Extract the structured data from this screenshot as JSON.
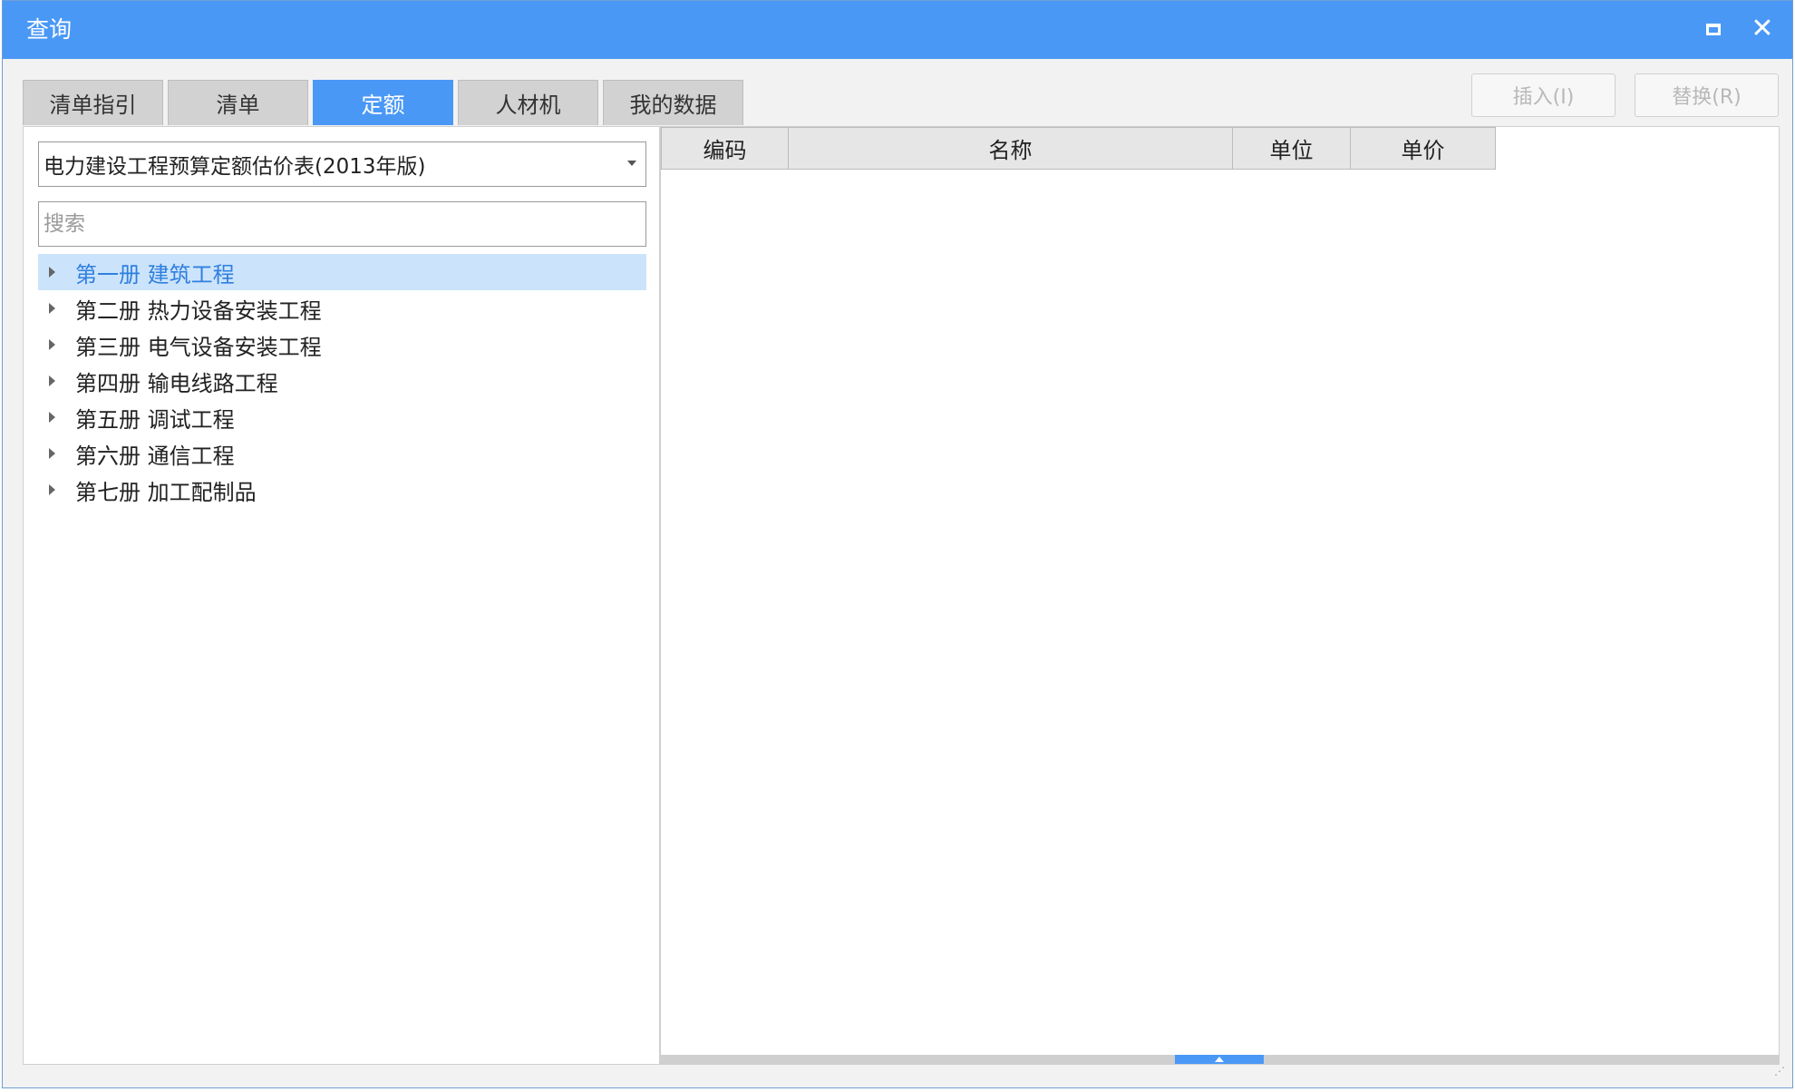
{
  "window": {
    "title": "查询",
    "maximize_icon": "maximize-icon",
    "close_icon": "close-icon",
    "accent_color": "#4a98f6"
  },
  "tabs": [
    {
      "label": "清单指引",
      "active": false
    },
    {
      "label": "清单",
      "active": false
    },
    {
      "label": "定额",
      "active": true
    },
    {
      "label": "人材机",
      "active": false
    },
    {
      "label": "我的数据",
      "active": false
    }
  ],
  "actions": {
    "insert_label": "插入(I)",
    "replace_label": "替换(R)"
  },
  "left": {
    "library_selected": "电力建设工程预算定额估价表(2013年版)",
    "search_placeholder": "搜索",
    "search_value": "",
    "tree": [
      {
        "label": "第一册 建筑工程",
        "selected": true
      },
      {
        "label": "第二册 热力设备安装工程",
        "selected": false
      },
      {
        "label": "第三册 电气设备安装工程",
        "selected": false
      },
      {
        "label": "第四册 输电线路工程",
        "selected": false
      },
      {
        "label": "第五册 调试工程",
        "selected": false
      },
      {
        "label": "第六册 通信工程",
        "selected": false
      },
      {
        "label": "第七册 加工配制品",
        "selected": false
      }
    ]
  },
  "grid": {
    "columns": [
      "编码",
      "名称",
      "单位",
      "单价"
    ],
    "rows": []
  }
}
